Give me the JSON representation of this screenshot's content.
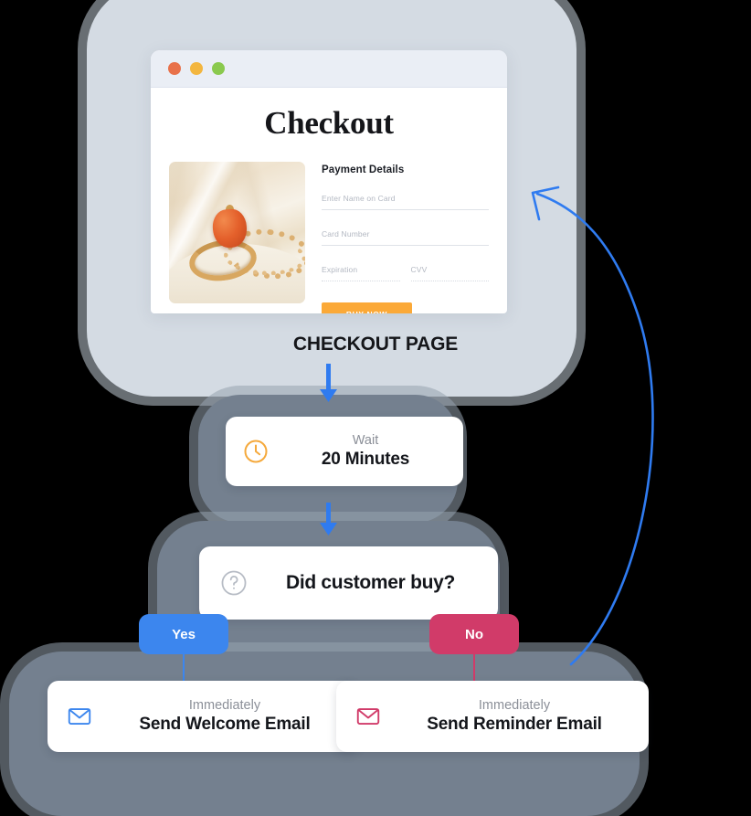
{
  "browser": {
    "traffic_lights": [
      "close-dot-red",
      "minimize-dot-yellow",
      "maximize-dot-green"
    ],
    "page_title": "Checkout",
    "payment_heading": "Payment Details",
    "fields": [
      {
        "name": "name-on-card-field",
        "placeholder": "Enter Name on Card"
      },
      {
        "name": "card-number-field",
        "placeholder": "Card Number"
      },
      {
        "name": "expiration-field",
        "placeholder": "Expiration"
      },
      {
        "name": "cvv-field",
        "placeholder": "CVV"
      }
    ],
    "buy_button_label": "BUY NOW",
    "product_image_alt": "gold ring with orange gemstone on cream silk"
  },
  "caption": {
    "checkout_page": "CHECKOUT PAGE"
  },
  "flow": {
    "wait_node": {
      "icon": "clock-icon",
      "sub": "Wait",
      "main": "20 Minutes"
    },
    "decision_node": {
      "icon": "question-mark-icon",
      "label": "Did customer buy?"
    },
    "branches": {
      "yes_label": "Yes",
      "no_label": "No"
    },
    "email_yes": {
      "icon": "envelope-icon",
      "sub": "Immediately",
      "main": "Send Welcome Email"
    },
    "email_no": {
      "icon": "envelope-icon",
      "sub": "Immediately",
      "main": "Send Reminder Email"
    }
  },
  "colors": {
    "background": "#000000",
    "panel_light": "#d4dbe3",
    "panel_slate": "#74808f",
    "accent_blue": "#3c86ee",
    "accent_pink": "#d13b69",
    "accent_orange": "#fba938",
    "clock_orange": "#f5a93c",
    "arrow_blue": "#2f7bf0"
  }
}
